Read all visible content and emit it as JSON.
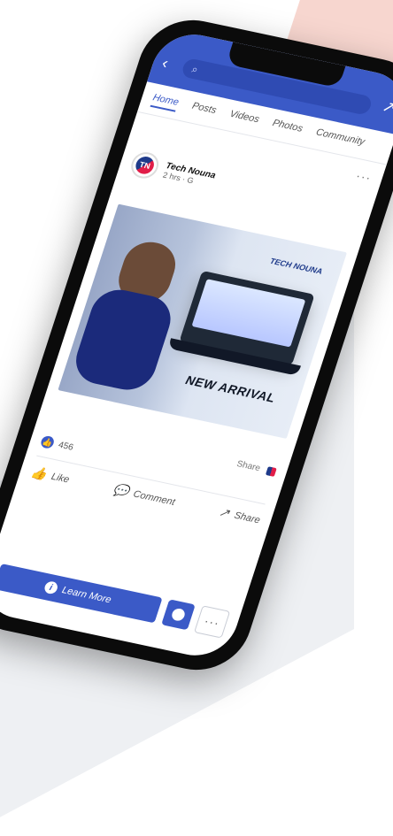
{
  "top_bar": {
    "back_icon": "chevron-left-icon",
    "search_icon": "search-icon",
    "search_placeholder": "",
    "share_icon": "share-icon"
  },
  "tabs": [
    {
      "label": "Home"
    },
    {
      "label": "Posts"
    },
    {
      "label": "Videos"
    },
    {
      "label": "Photos"
    },
    {
      "label": "Community"
    }
  ],
  "post": {
    "page_name": "Tech Nouna",
    "time": "2 hrs · G",
    "more": "···",
    "image": {
      "brand_tag": "TECH NOUNA",
      "banner_text": "NEW ARRIVAL"
    },
    "share_count_text": "Share",
    "reactions_count": "456",
    "actions": {
      "like": "Like",
      "comment": "Comment",
      "share": "Share"
    },
    "cta": {
      "learn_more": "Learn More"
    }
  }
}
